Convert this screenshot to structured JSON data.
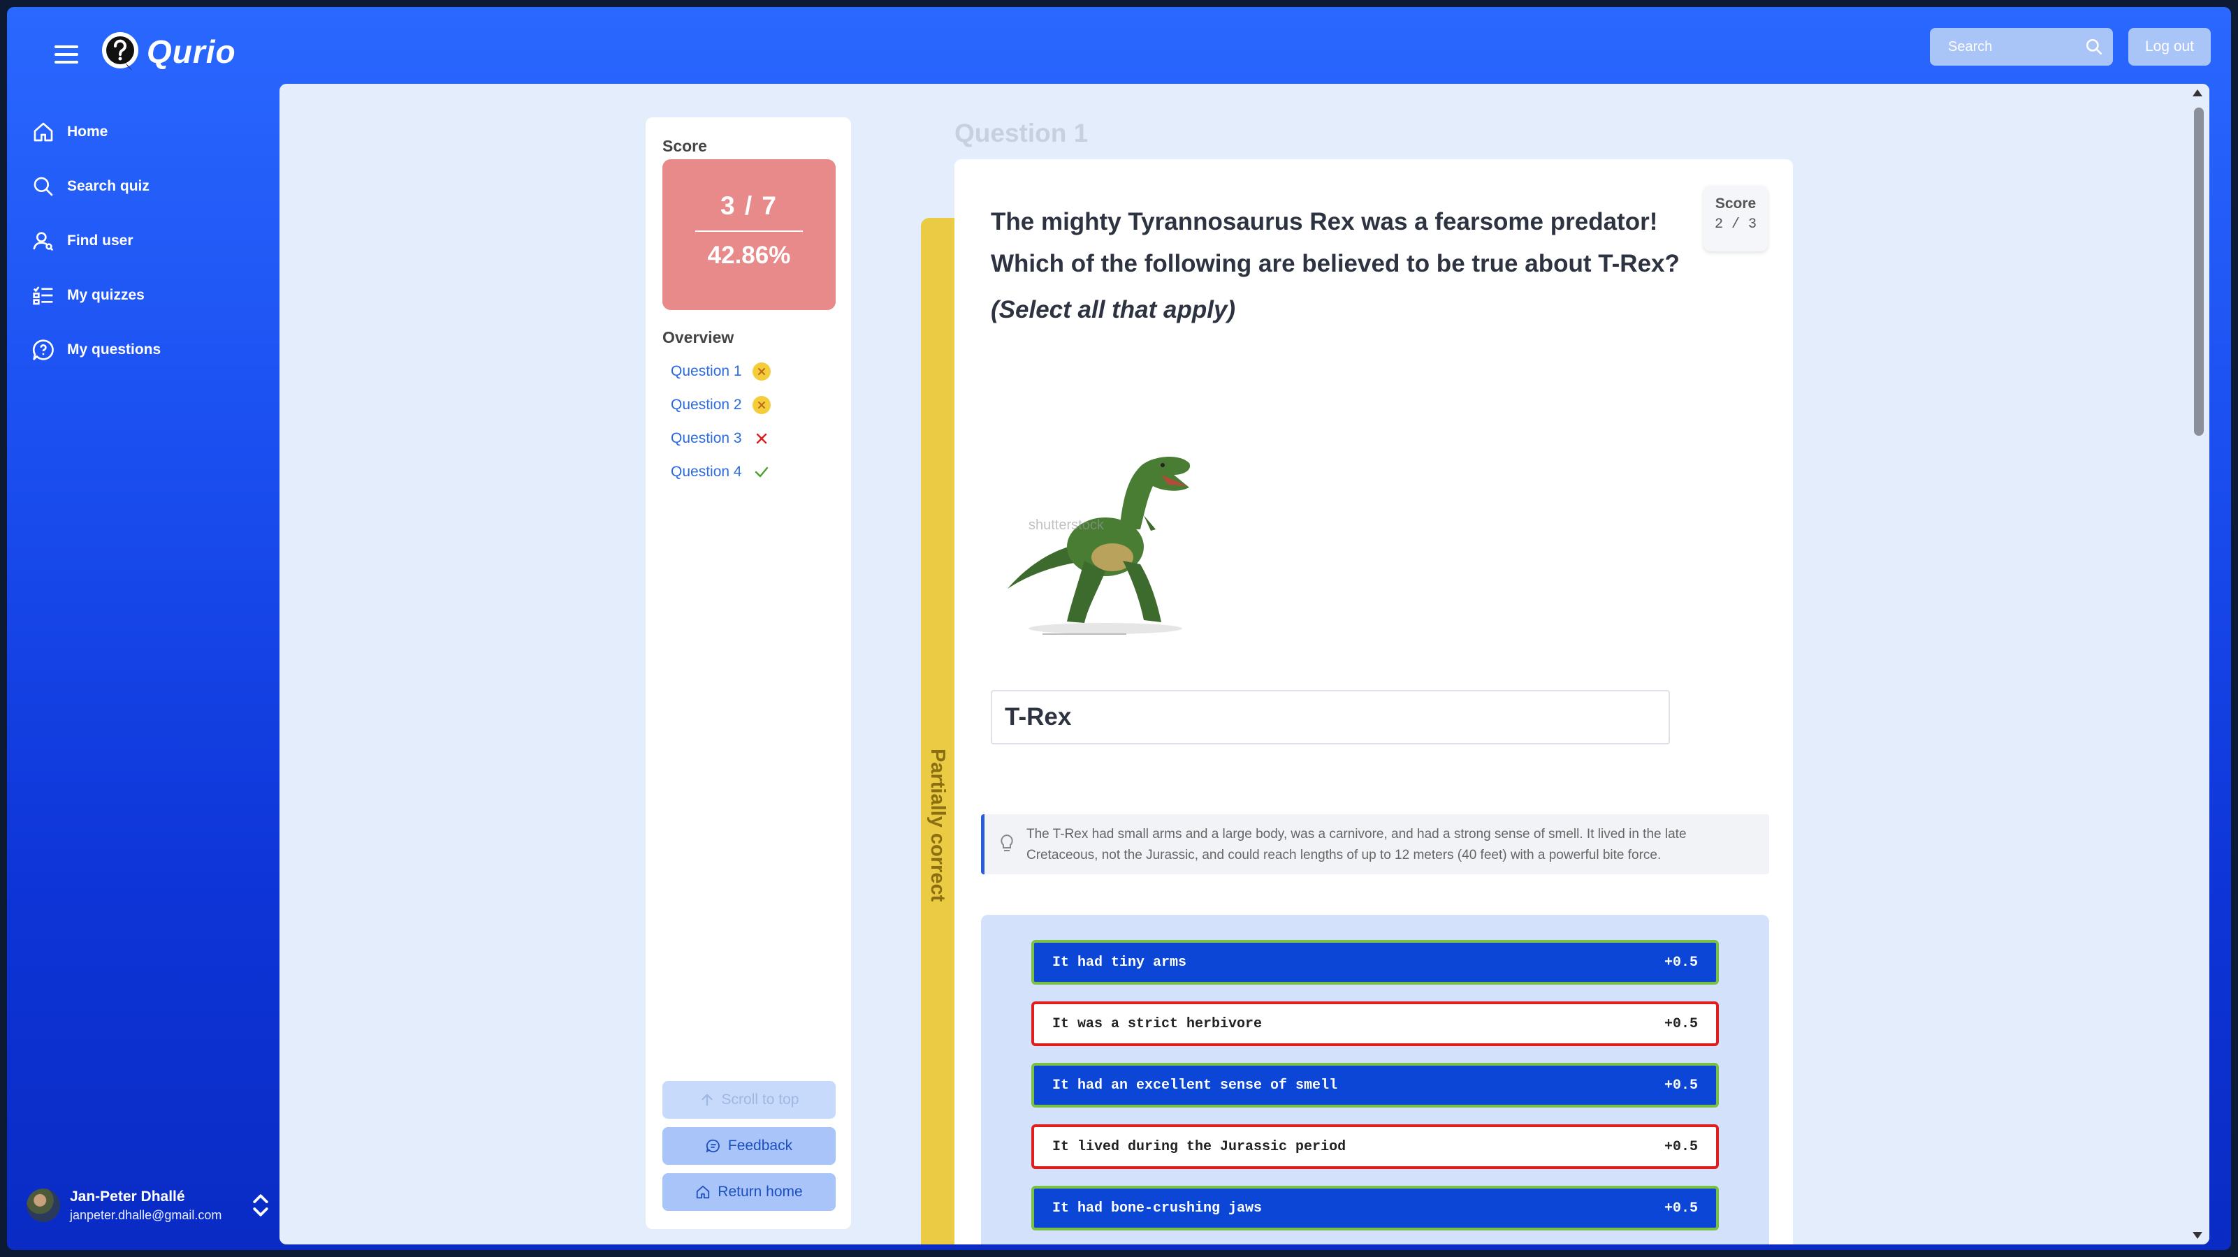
{
  "app": {
    "name": "Qurio"
  },
  "header": {
    "search_placeholder": "Search",
    "logout_label": "Log out"
  },
  "sidebar": {
    "items": [
      {
        "label": "Home",
        "icon": "home-icon"
      },
      {
        "label": "Search quiz",
        "icon": "search-icon"
      },
      {
        "label": "Find user",
        "icon": "user-icon"
      },
      {
        "label": "My quizzes",
        "icon": "list-icon"
      },
      {
        "label": "My questions",
        "icon": "question-bubble-icon"
      }
    ],
    "user": {
      "name": "Jan-Peter Dhallé",
      "email": "janpeter.dhalle@gmail.com"
    }
  },
  "score_panel": {
    "title": "Score",
    "fraction": "3 / 7",
    "percent": "42.86%",
    "overview_title": "Overview",
    "questions": [
      {
        "label": "Question 1",
        "status": "partial"
      },
      {
        "label": "Question 2",
        "status": "partial"
      },
      {
        "label": "Question 3",
        "status": "wrong"
      },
      {
        "label": "Question 4",
        "status": "correct"
      }
    ],
    "buttons": {
      "scroll_top": "Scroll to top",
      "feedback": "Feedback",
      "return_home": "Return home"
    }
  },
  "question": {
    "heading": "Question 1",
    "status_label": "Partially correct",
    "text": "The mighty Tyrannosaurus Rex was a fearsome predator! Which of the following are believed to be true about T-Rex?",
    "hint": "(Select all that apply)",
    "score_label": "Score",
    "score_value": "2 / 3",
    "answer": "T-Rex",
    "explanation": "The T-Rex had small arms and a large body, was a carnivore, and had a strong sense of smell. It lived in the late Cretaceous, not the Jurassic, and could reach lengths of up to 12 meters (40 feet) with a powerful bite force.",
    "options": [
      {
        "text": "It had tiny arms",
        "points": "+0.5",
        "state": "selected"
      },
      {
        "text": "It was a strict herbivore",
        "points": "+0.5",
        "state": "wrong"
      },
      {
        "text": "It had an excellent sense of smell",
        "points": "+0.5",
        "state": "selected"
      },
      {
        "text": "It lived during the Jurassic period",
        "points": "+0.5",
        "state": "wrong"
      },
      {
        "text": "It had bone-crushing jaws",
        "points": "+0.5",
        "state": "selected"
      }
    ]
  },
  "colors": {
    "accent": "#1b4ff0",
    "partial": "#eccb44",
    "correct_border": "#7ac043",
    "wrong_border": "#e01c1c",
    "score_card": "#e88a8a"
  }
}
